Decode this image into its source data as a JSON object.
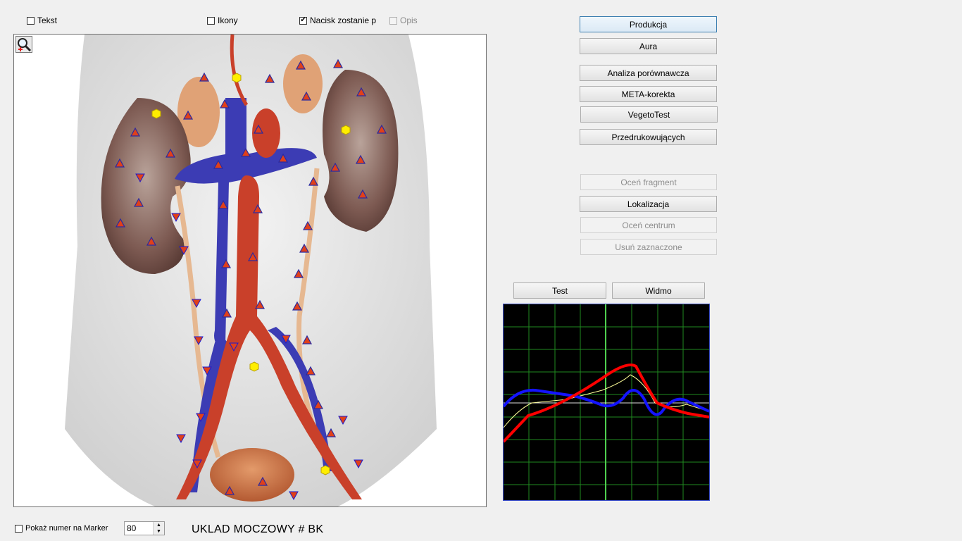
{
  "toolbar": {
    "tekst": {
      "label": "Tekst",
      "checked": false
    },
    "ikony": {
      "label": "Ikony",
      "checked": false
    },
    "nacisk": {
      "label": "Nacisk zostanie p",
      "checked": true
    },
    "opis": {
      "label": "Opis",
      "checked": false,
      "disabled": true
    }
  },
  "actions": {
    "produkcja": "Produkcja",
    "aura": "Aura",
    "analiza": "Analiza porównawcza",
    "meta": "META-korekta",
    "vegeto": "VegetoTest",
    "przedruk": "Przedrukowujących",
    "ocen_fragment": "Oceń fragment",
    "lokalizacja": "Lokalizacja",
    "ocen_centrum": "Oceń centrum",
    "usun": "Usuń zaznaczone"
  },
  "graph_tabs": {
    "test": "Test",
    "widmo": "Widmo"
  },
  "footer": {
    "pokaz_label": "Pokaż numer na Marker",
    "pokaz_checked": false,
    "marker_value": "80",
    "organ_title": "UKLAD MOCZOWY # BK"
  },
  "colors": {
    "graph_bg": "#000000",
    "grid": "#1f8a1f",
    "series_red": "#ff0000",
    "series_blue": "#1414ff",
    "series_yellow": "#ffff99",
    "marker_up": "#e0401a",
    "marker_down": "#1a1ad0",
    "marker_hex": "#ffee00"
  },
  "icons": {
    "zoom": "magnifier-zoom-icon"
  }
}
